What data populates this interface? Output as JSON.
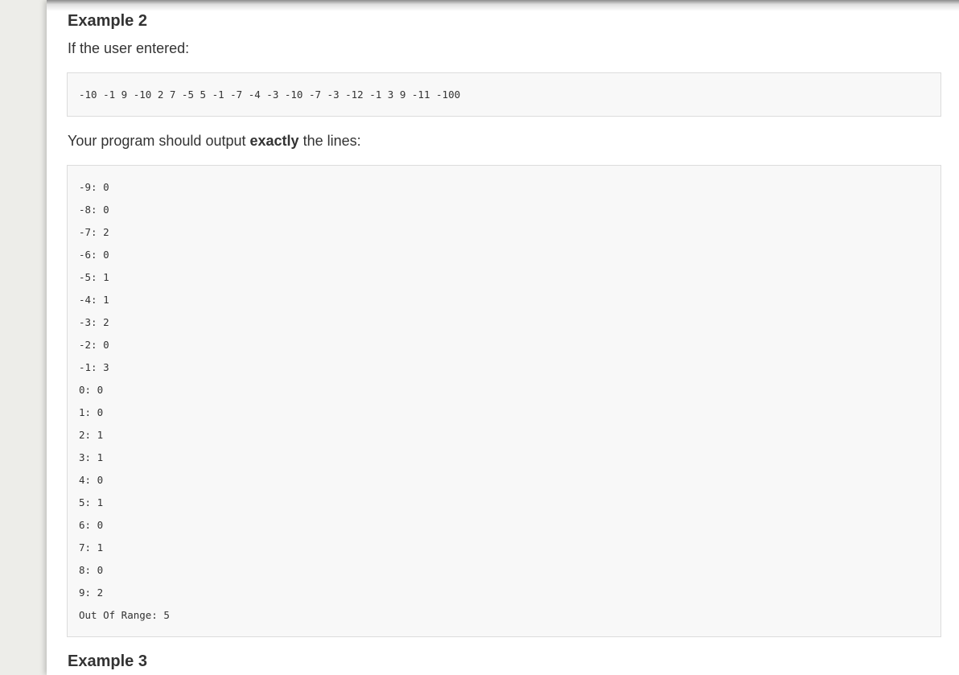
{
  "example2": {
    "heading": "Example 2",
    "intro": "If the user entered:",
    "input": "-10 -1 9 -10 2 7 -5 5 -1 -7 -4 -3 -10 -7 -3 -12 -1 3 9 -11 -100",
    "output_intro_before": "Your program should output ",
    "output_intro_bold": "exactly",
    "output_intro_after": " the lines:",
    "output_lines": [
      "-9: 0",
      "-8: 0",
      "-7: 2",
      "-6: 0",
      "-5: 1",
      "-4: 1",
      "-3: 2",
      "-2: 0",
      "-1: 3",
      "0: 0",
      "1: 0",
      "2: 1",
      "3: 1",
      "4: 0",
      "5: 1",
      "6: 0",
      "7: 1",
      "8: 0",
      "9: 2",
      "Out Of Range: 5"
    ]
  },
  "example3": {
    "heading": "Example 3"
  }
}
